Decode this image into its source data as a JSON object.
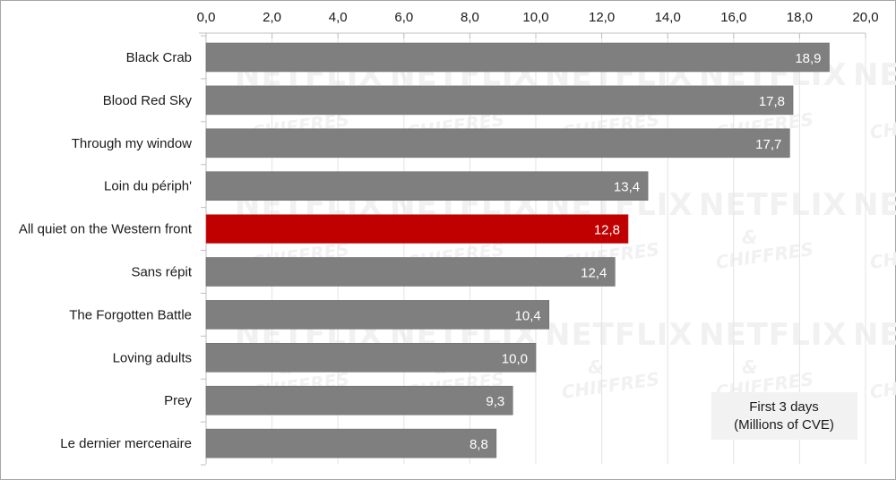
{
  "chart_data": {
    "type": "bar",
    "orientation": "horizontal",
    "title": "",
    "xlabel": "",
    "ylabel": "",
    "xlim": [
      0,
      20
    ],
    "x_ticks": [
      "0,0",
      "2,0",
      "4,0",
      "6,0",
      "8,0",
      "10,0",
      "12,0",
      "14,0",
      "16,0",
      "18,0",
      "20,0"
    ],
    "x_tick_values": [
      0,
      2,
      4,
      6,
      8,
      10,
      12,
      14,
      16,
      18,
      20
    ],
    "x_axis_position": "top",
    "grid": true,
    "categories": [
      "Black Crab",
      "Blood Red Sky",
      "Through my window",
      "Loin du périph'",
      "All quiet on the Western front",
      "Sans répit",
      "The Forgotten Battle",
      "Loving adults",
      "Prey",
      "Le dernier mercenaire"
    ],
    "values": [
      18.9,
      17.8,
      17.7,
      13.4,
      12.8,
      12.4,
      10.4,
      10.0,
      9.3,
      8.8
    ],
    "value_labels": [
      "18,9",
      "17,8",
      "17,7",
      "13,4",
      "12,8",
      "12,4",
      "10,4",
      "10,0",
      "9,3",
      "8,8"
    ],
    "highlight_index": 4,
    "colors": {
      "default": "#7f7f7f",
      "highlight": "#c00000",
      "gridline": "#e3e3e3",
      "axis": "#bfbfbf"
    },
    "legend": {
      "lines": [
        "First 3 days",
        "(Millions of CVE)"
      ],
      "placement": "bottom-right",
      "background": "#f2f2f2"
    },
    "watermark": {
      "line1": "NETFLIX",
      "line2": "&",
      "line3": "CHIFFRES"
    }
  }
}
